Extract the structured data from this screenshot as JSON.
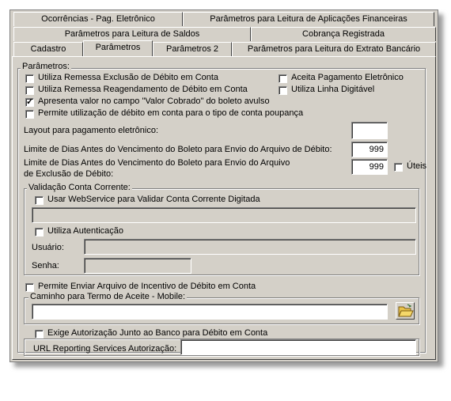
{
  "tabs": {
    "row1": [
      "Ocorrências - Pag. Eletrônico",
      "Parâmetros para Leitura de Aplicações Financeiras"
    ],
    "row2": [
      "Parâmetros para Leitura de Saldos",
      "Cobrança Registrada"
    ],
    "row3": [
      "Cadastro",
      "Parâmetros",
      "Parâmetros 2",
      "Parâmetros para Leitura do Extrato Bancário"
    ],
    "active": "Parâmetros"
  },
  "parametros": {
    "group_title": "Parâmetros:",
    "cb_remessa_exclusao": {
      "label": "Utiliza Remessa Exclusão de Débito em Conta",
      "checked": false
    },
    "cb_remessa_reagendamento": {
      "label": "Utiliza Remessa Reagendamento de Débito em Conta",
      "checked": false
    },
    "cb_valor_cobrado": {
      "label": "Apresenta valor no campo \"Valor Cobrado\" do boleto avulso",
      "checked": true
    },
    "cb_debito_poupanca": {
      "label": "Permite utilização de débito em conta para o tipo de conta poupança",
      "checked": false
    },
    "cb_aceita_pagamento": {
      "label": "Aceita Pagamento Eletrônico",
      "checked": false
    },
    "cb_linha_digitavel": {
      "label": "Utiliza Linha Digitável",
      "checked": false
    },
    "layout_label": "Layout para pagamento eletrônico:",
    "layout_value": "",
    "limite_debito_label": "Limite de Dias Antes do Vencimento do Boleto para Envio do Arquivo de Débito:",
    "limite_debito_value": "999",
    "limite_exclusao_label_1": "Limite de Dias Antes do Vencimento do Boleto para Envio do Arquivo",
    "limite_exclusao_label_2": "de Exclusão de Débito:",
    "limite_exclusao_value": "999",
    "uteis_label": "Úteis",
    "check_mark": "✓"
  },
  "validacao": {
    "group_title": "Validação Conta Corrente:",
    "cb_webservice": "Usar WebService para Validar Conta Corrente Digitada",
    "webservice_value": "",
    "cb_autenticacao": "Utiliza Autenticação",
    "usuario_label": "Usuário:",
    "usuario_value": "",
    "senha_label": "Senha:",
    "senha_value": ""
  },
  "incentivo": {
    "label": "Permite Enviar Arquivo de Incentivo de Débito em Conta"
  },
  "termo": {
    "group_title": "Caminho para Termo de Aceite - Mobile:",
    "path_value": "",
    "folder_icon": "folder-open-icon"
  },
  "autorizacao": {
    "cb_label": "Exige Autorização Junto ao Banco para Débito em Conta",
    "url_label": "URL Reporting Services Autorização:",
    "url_value": ""
  }
}
